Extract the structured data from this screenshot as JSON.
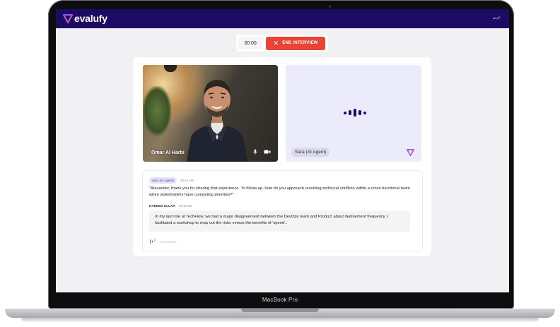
{
  "device": {
    "label": "MacBook Pro"
  },
  "topbar": {
    "brand": "evalufy",
    "language_link": "عربي"
  },
  "controls": {
    "timer": "30:00",
    "end_label": "END INTERVIEW"
  },
  "participants": {
    "user": {
      "name": "Omar Al Harbi"
    },
    "agent": {
      "name": "Sara (AI Agent)"
    }
  },
  "transcript": {
    "agent_badge": "Sara (AI Agent)",
    "agent_time": "10:14 AM",
    "agent_text": "\"Alexander, thank you for sharing that experience. To follow up, how do you approach resolving technical conflicts within a cross-functional team when stakeholders have competing priorities?\"",
    "candidate_name": "HADEED ULLAH",
    "candidate_time": "10:15 AM",
    "candidate_text": "In my last role at TechFlow, we had a major disagreement between the DevOps team and Product about deployment frequency. I facilitated a workshop to map out the risks versus the benefits of 'speed'..",
    "listening_label": "LISTENING..."
  },
  "colors": {
    "brand_navy": "#1d0b63",
    "end_button": "#ea4335",
    "agent_tile": "#ecebfb"
  },
  "icons": [
    "evalufy-logo-icon",
    "close-icon",
    "microphone-icon",
    "camera-icon",
    "voice-wave-icon",
    "listening-icon"
  ]
}
